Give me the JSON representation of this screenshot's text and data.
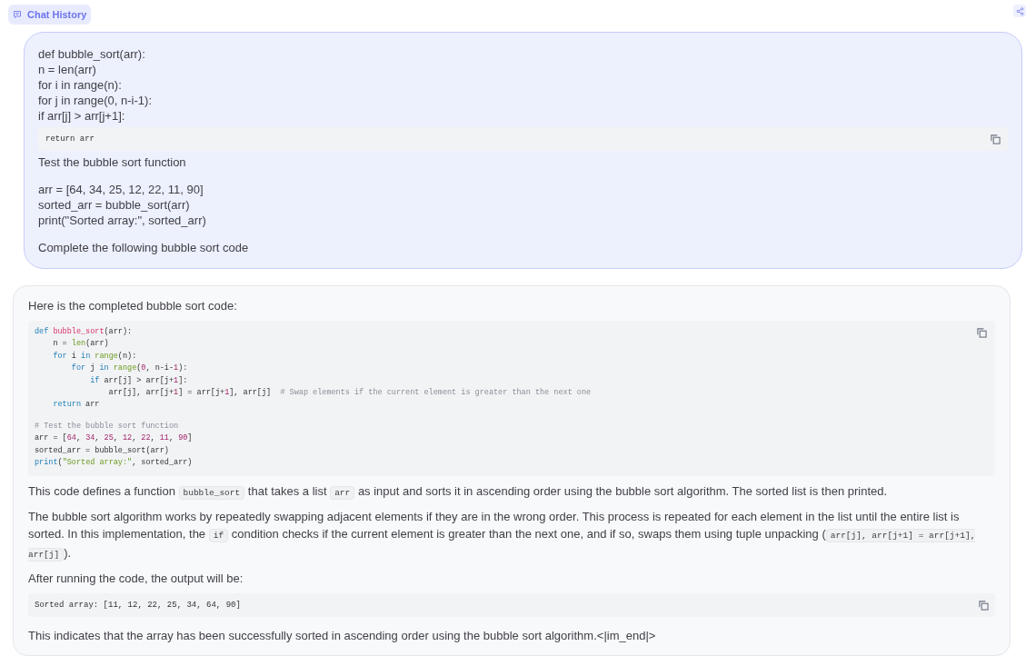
{
  "header": {
    "title": "Chat History"
  },
  "user_message": {
    "lines_before": [
      "def bubble_sort(arr):",
      "n = len(arr)",
      "for i in range(n):",
      "for j in range(0, n-i-1):",
      "if arr[j] > arr[j+1]:"
    ],
    "code": "return arr",
    "lines_after": [
      [
        "Test the bubble sort function"
      ],
      [
        "arr = [64, 34, 25, 12, 22, 11, 90]",
        "sorted_arr = bubble_sort(arr)",
        "print(\"Sorted array:\", sorted_arr)"
      ],
      [
        "Complete the following bubble sort code"
      ]
    ]
  },
  "response": {
    "intro": "Here is the completed bubble sort code:",
    "code_groups": [
      [
        [
          {
            "text": "def ",
            "kind": "keyword"
          },
          {
            "text": "bubble_sort",
            "kind": "func"
          },
          {
            "text": "(arr):",
            "kind": "plain"
          }
        ],
        [
          {
            "text": "    n = ",
            "kind": "plain"
          },
          {
            "text": "len",
            "kind": "builtin"
          },
          {
            "text": "(arr)",
            "kind": "plain"
          }
        ],
        [
          {
            "text": "    for",
            "kind": "keyword"
          },
          {
            "text": " i ",
            "kind": "plain"
          },
          {
            "text": "in ",
            "kind": "keyword"
          },
          {
            "text": "range",
            "kind": "builtin"
          },
          {
            "text": "(n):",
            "kind": "plain"
          }
        ],
        [
          {
            "text": "        for",
            "kind": "keyword"
          },
          {
            "text": " j ",
            "kind": "plain"
          },
          {
            "text": "in ",
            "kind": "keyword"
          },
          {
            "text": "range",
            "kind": "builtin"
          },
          {
            "text": "(",
            "kind": "plain"
          },
          {
            "text": "0",
            "kind": "number"
          },
          {
            "text": ", n-i-",
            "kind": "plain"
          },
          {
            "text": "1",
            "kind": "number"
          },
          {
            "text": "):",
            "kind": "plain"
          }
        ],
        [
          {
            "text": "            if",
            "kind": "keyword"
          },
          {
            "text": " arr[j] > arr[j+",
            "kind": "plain"
          },
          {
            "text": "1",
            "kind": "number"
          },
          {
            "text": "]:",
            "kind": "plain"
          }
        ],
        [
          {
            "text": "                arr[j], arr[j+",
            "kind": "plain"
          },
          {
            "text": "1",
            "kind": "number"
          },
          {
            "text": "] = arr[j+",
            "kind": "plain"
          },
          {
            "text": "1",
            "kind": "number"
          },
          {
            "text": "], arr[j]  ",
            "kind": "plain"
          },
          {
            "text": "# Swap elements if the current element is greater than the next one",
            "kind": "comment"
          }
        ],
        [
          {
            "text": "    return",
            "kind": "keyword"
          },
          {
            "text": " arr",
            "kind": "plain"
          }
        ]
      ],
      [
        [
          {
            "text": "# Test the bubble sort function",
            "kind": "comment"
          }
        ],
        [
          {
            "text": "arr = [",
            "kind": "plain"
          },
          {
            "text": "64",
            "kind": "number"
          },
          {
            "text": ", ",
            "kind": "plain"
          },
          {
            "text": "34",
            "kind": "number"
          },
          {
            "text": ", ",
            "kind": "plain"
          },
          {
            "text": "25",
            "kind": "number"
          },
          {
            "text": ", ",
            "kind": "plain"
          },
          {
            "text": "12",
            "kind": "number"
          },
          {
            "text": ", ",
            "kind": "plain"
          },
          {
            "text": "22",
            "kind": "number"
          },
          {
            "text": ", ",
            "kind": "plain"
          },
          {
            "text": "11",
            "kind": "number"
          },
          {
            "text": ", ",
            "kind": "plain"
          },
          {
            "text": "90",
            "kind": "number"
          },
          {
            "text": "]",
            "kind": "plain"
          }
        ],
        [
          {
            "text": "sorted_arr = bubble_sort(arr)",
            "kind": "plain"
          }
        ],
        [
          {
            "text": "print",
            "kind": "keyword"
          },
          {
            "text": "(",
            "kind": "plain"
          },
          {
            "text": "\"Sorted array:\"",
            "kind": "string"
          },
          {
            "text": ", sorted_arr)",
            "kind": "plain"
          }
        ]
      ]
    ],
    "paragraph_1": [
      {
        "text": "This code defines a function ",
        "kind": "text"
      },
      {
        "text": "bubble_sort",
        "kind": "code"
      },
      {
        "text": " that takes a list ",
        "kind": "text"
      },
      {
        "text": "arr",
        "kind": "code"
      },
      {
        "text": " as input and sorts it in ascending order using the bubble sort algorithm. The sorted list is then printed.",
        "kind": "text"
      }
    ],
    "paragraph_2": [
      {
        "text": "The bubble sort algorithm works by repeatedly swapping adjacent elements if they are in the wrong order. This process is repeated for each element in the list until the entire list is sorted. In this implementation, the ",
        "kind": "text"
      },
      {
        "text": "if",
        "kind": "code"
      },
      {
        "text": " condition checks if the current element is greater than the next one, and if so, swaps them using tuple unpacking (",
        "kind": "text"
      },
      {
        "text": "arr[j], arr[j+1] = arr[j+1], arr[j]",
        "kind": "code"
      },
      {
        "text": ").",
        "kind": "text"
      }
    ],
    "paragraph_3": "After running the code, the output will be:",
    "output_code": "Sorted array: [11, 12, 22, 25, 34, 64, 90]",
    "paragraph_4": "This indicates that the array has been successfully sorted in ascending order using the bubble sort algorithm.<|im_end|>"
  }
}
